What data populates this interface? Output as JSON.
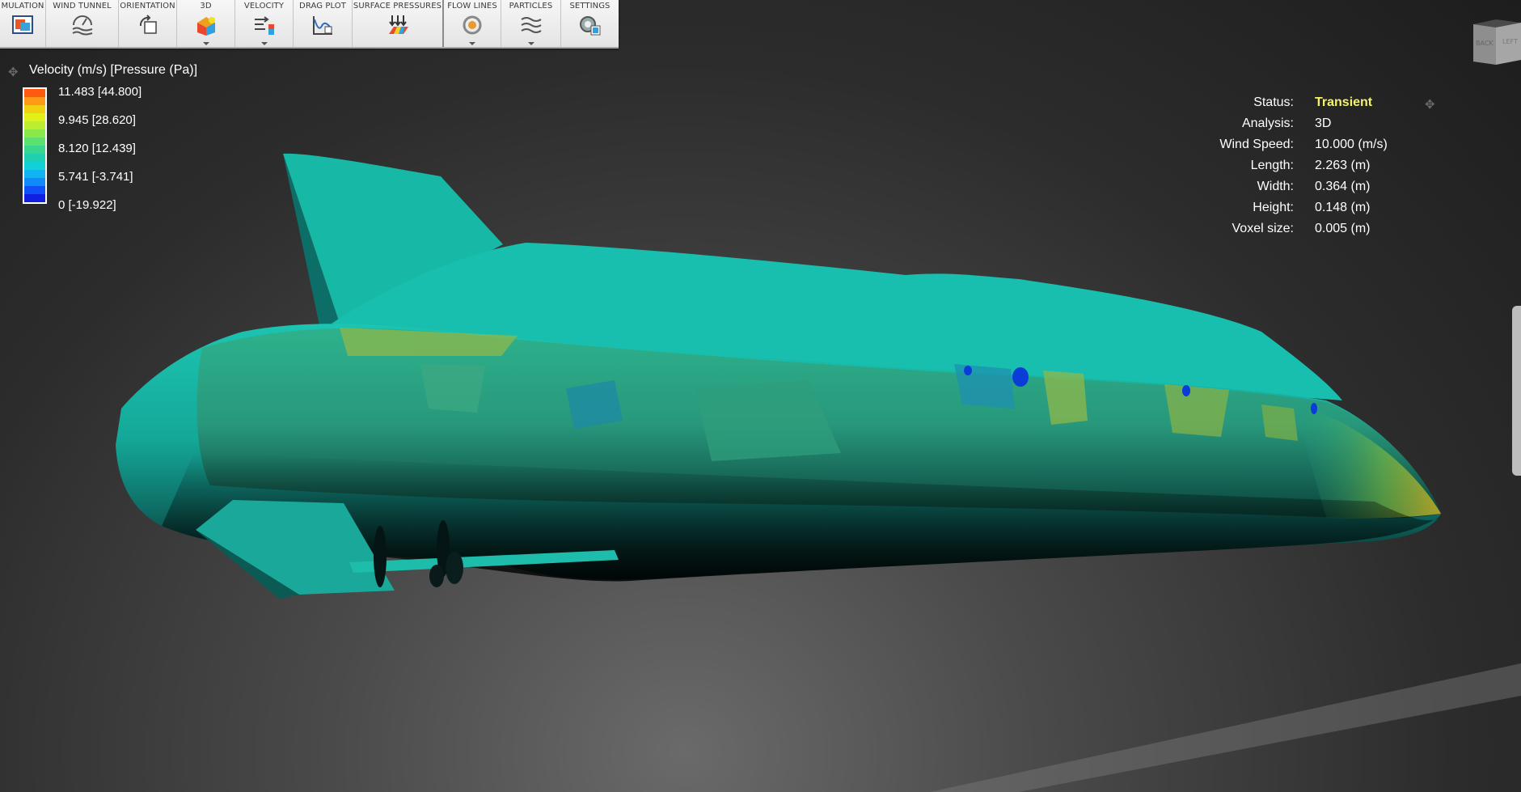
{
  "ribbon": {
    "groups": [
      {
        "label": "MULATION",
        "icon": "simulation-icon",
        "dropdown": false
      },
      {
        "label": "WIND TUNNEL",
        "icon": "wind-tunnel-icon",
        "dropdown": false
      },
      {
        "label": "ORIENTATION",
        "icon": "orientation-icon",
        "dropdown": false
      },
      {
        "label": "3D",
        "icon": "3d-view-icon",
        "dropdown": true
      },
      {
        "label": "VELOCITY",
        "icon": "velocity-icon",
        "dropdown": true
      },
      {
        "label": "DRAG PLOT",
        "icon": "drag-plot-icon",
        "dropdown": false
      },
      {
        "label": "SURFACE PRESSURES",
        "icon": "surface-pressures-icon",
        "dropdown": false
      },
      {
        "label": "FLOW LINES",
        "icon": "flow-lines-icon",
        "dropdown": true
      },
      {
        "label": "PARTICLES",
        "icon": "particles-icon",
        "dropdown": true
      },
      {
        "label": "SETTINGS",
        "icon": "settings-icon",
        "dropdown": false
      }
    ]
  },
  "legend": {
    "title": "Velocity (m/s) [Pressure (Pa)]",
    "labels": [
      "11.483 [44.800]",
      "9.945 [28.620]",
      "8.120 [12.439]",
      "5.741 [-3.741]",
      "0 [-19.922]"
    ],
    "colors": [
      "#ff5a10",
      "#ff9a18",
      "#f0d010",
      "#e0f018",
      "#bbee30",
      "#8ae848",
      "#5ce070",
      "#38d68e",
      "#1ed0b0",
      "#10d0d8",
      "#10b4f0",
      "#108cf8",
      "#1050f8",
      "#1020e0"
    ]
  },
  "info": {
    "rows": [
      {
        "key": "Status:",
        "value": "Transient"
      },
      {
        "key": "Analysis:",
        "value": "3D"
      },
      {
        "key": "Wind Speed:",
        "value": "10.000 (m/s)"
      },
      {
        "key": "Length:",
        "value": "2.263 (m)"
      },
      {
        "key": "Width:",
        "value": "0.364 (m)"
      },
      {
        "key": "Height:",
        "value": "0.148 (m)"
      },
      {
        "key": "Voxel size:",
        "value": "0.005 (m)"
      }
    ],
    "status_color": "#f2f270"
  },
  "viewcube": {
    "back_label": "BACK",
    "left_label": "LEFT"
  },
  "model": {
    "surface_color": "#14b8a8"
  }
}
